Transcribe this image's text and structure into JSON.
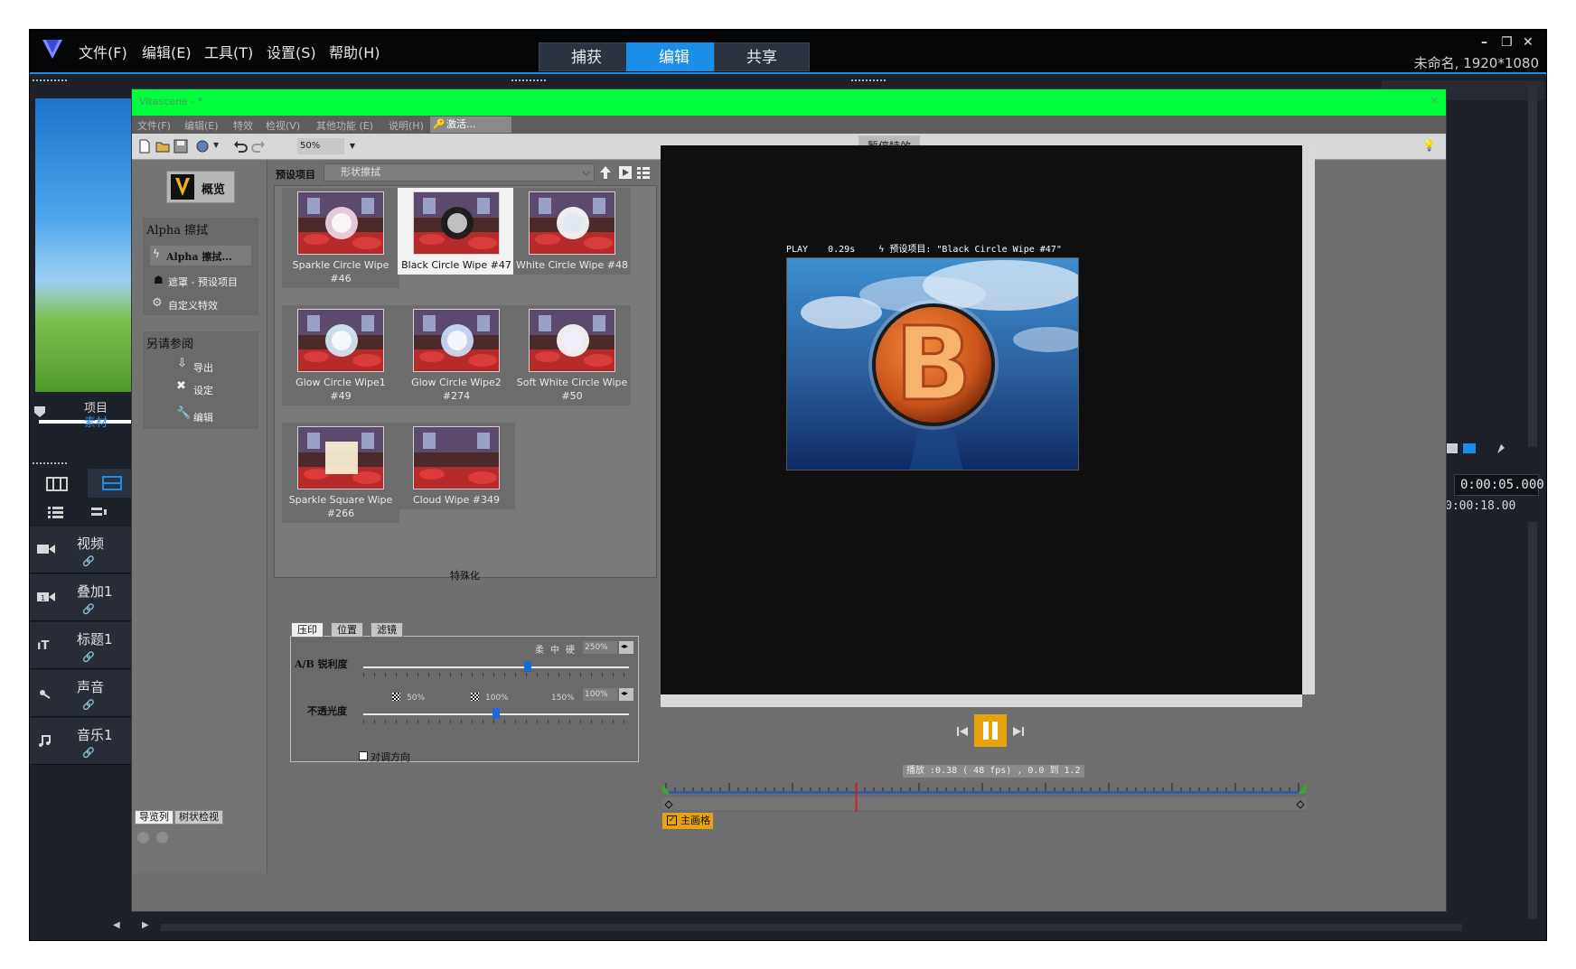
{
  "host": {
    "menu": [
      "文件(F)",
      "编辑(E)",
      "工具(T)",
      "设置(S)",
      "帮助(H)"
    ],
    "tabs": [
      "捕获",
      "编辑",
      "共享"
    ],
    "active_tab": "编辑",
    "window_title": "未命名, 1920*1080",
    "project_label": "项目",
    "clip_label": "素材",
    "timecode_current": "0:00:05.000",
    "timecode_duration": "0:00:18.00",
    "tracks": [
      {
        "label": "视频",
        "icon": "video-track-icon"
      },
      {
        "label": "叠加1",
        "icon": "overlay-track-icon"
      },
      {
        "label": "标题1",
        "icon": "title-track-icon"
      },
      {
        "label": "声音",
        "icon": "voice-track-icon"
      },
      {
        "label": "音乐1",
        "icon": "music-track-icon"
      }
    ]
  },
  "vitascene": {
    "title": "Vitascene - *",
    "menu": [
      "文件(F)",
      "编辑(E)",
      "特效",
      "检视(V)",
      "其他功能 (E)",
      "说明(H)"
    ],
    "activate_label": "激活...",
    "zoom": "50%",
    "pause_effects_label": "暂停特效",
    "nav": {
      "overview_label": "概览",
      "group1_title": "Alpha 擦拭",
      "group1_items": [
        "Alpha 擦拭...",
        "遮罩 - 预设项目",
        "自定义特效"
      ],
      "group2_title": "另请参阅",
      "group2_items": [
        "导出",
        "设定",
        "编辑"
      ],
      "bottom_tabs": [
        "导览列",
        "树状检视"
      ]
    },
    "preset_label": "预设项目",
    "preset_category": "形状擦拭",
    "presets": [
      {
        "name": "Sparkle Circle Wipe #46",
        "selected": false
      },
      {
        "name": "Black Circle Wipe #47",
        "selected": true
      },
      {
        "name": "White Circle Wipe #48",
        "selected": false
      },
      {
        "name": "Glow Circle Wipe1 #49",
        "selected": false
      },
      {
        "name": "Glow Circle Wipe2 #274",
        "selected": false
      },
      {
        "name": "Soft White Circle Wipe #50",
        "selected": false
      },
      {
        "name": "Sparkle Square Wipe #266",
        "selected": false
      },
      {
        "name": "Cloud Wipe #349",
        "selected": false
      }
    ],
    "special_label": "特殊化",
    "settings": {
      "tabs": [
        "压印",
        "位置",
        "滤镜"
      ],
      "sharpness_label": "A/B 锐利度",
      "sharpness_scale": [
        "柔",
        "中",
        "硬"
      ],
      "sharpness_value": "250%",
      "sharpness_level": 0.62,
      "opacity_label": "不透光度",
      "opacity_scale": [
        "50%",
        "100%",
        "150%"
      ],
      "opacity_value": "100%",
      "opacity_level": 0.5,
      "reverse_label": "对调方向"
    },
    "preview": {
      "hud_play": "PLAY",
      "hud_time": "0.29s",
      "hud_preset": "预设项目: \"Black Circle Wipe #47\"",
      "logo_letter": "B"
    },
    "transport": {
      "play_info": "播放 :0.38 ( 48 fps) , 0.0 到 1.2",
      "playhead_fraction": 0.3,
      "main_grid_label": "主画格"
    }
  },
  "colors": {
    "accent_blue": "#1a8ee8",
    "titlebar_green": "#00ff3c",
    "transport_orange": "#e8a20b"
  }
}
